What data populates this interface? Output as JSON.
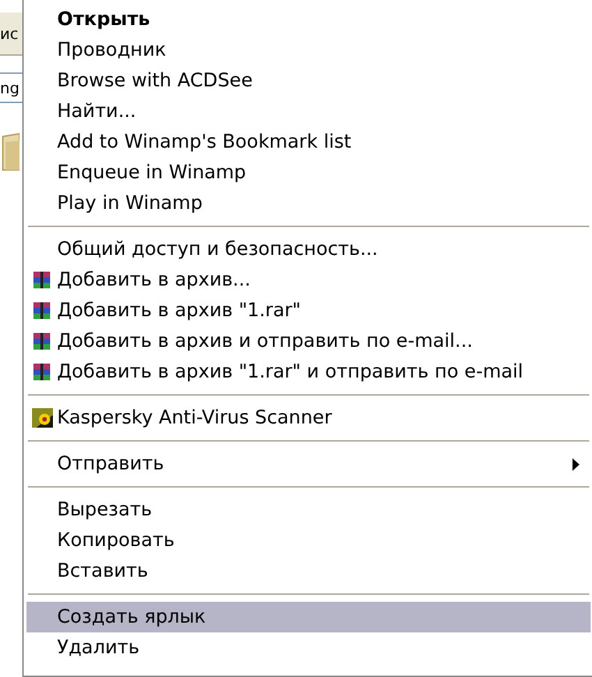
{
  "background": {
    "texts": [
      "ис",
      "ng"
    ]
  },
  "menu": [
    {
      "kind": "default",
      "label": "Открыть",
      "selected": false
    },
    {
      "kind": "item",
      "label": "Проводник",
      "selected": false
    },
    {
      "kind": "item",
      "label": "Browse with ACDSee",
      "selected": false
    },
    {
      "kind": "item",
      "label": "Найти...",
      "selected": false
    },
    {
      "kind": "item",
      "label": "Add to Winamp's Bookmark list",
      "selected": false
    },
    {
      "kind": "item",
      "label": "Enqueue in Winamp",
      "selected": false
    },
    {
      "kind": "item",
      "label": "Play in Winamp",
      "selected": false
    },
    {
      "kind": "separator"
    },
    {
      "kind": "item",
      "label": "Общий доступ и безопасность...",
      "selected": false
    },
    {
      "kind": "archive",
      "label": "Добавить в архив...",
      "selected": false
    },
    {
      "kind": "archive",
      "label": "Добавить в архив \"1.rar\"",
      "selected": false
    },
    {
      "kind": "archive",
      "label": "Добавить в архив и отправить по e-mail...",
      "selected": false
    },
    {
      "kind": "archive",
      "label": "Добавить в архив \"1.rar\" и отправить по e-mail",
      "selected": false
    },
    {
      "kind": "separator"
    },
    {
      "kind": "scanner",
      "label": "Kaspersky Anti-Virus Scanner",
      "selected": false
    },
    {
      "kind": "separator"
    },
    {
      "kind": "submenu",
      "label": "Отправить",
      "selected": false
    },
    {
      "kind": "separator"
    },
    {
      "kind": "item",
      "label": "Вырезать",
      "selected": false
    },
    {
      "kind": "item",
      "label": "Копировать",
      "selected": false
    },
    {
      "kind": "item",
      "label": "Вставить",
      "selected": false
    },
    {
      "kind": "separator"
    },
    {
      "kind": "item",
      "label": "Создать ярлык",
      "selected": true
    },
    {
      "kind": "item",
      "label": "Удалить",
      "selected": false
    }
  ]
}
